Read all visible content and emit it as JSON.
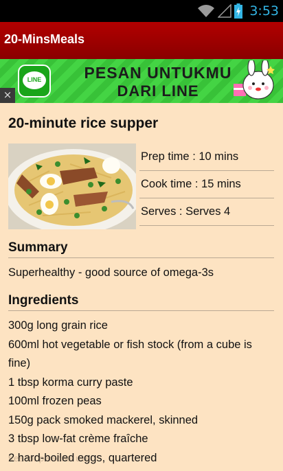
{
  "status_bar": {
    "time": "3:53",
    "icons": [
      "wifi-icon",
      "signal-icon",
      "battery-charging-icon"
    ],
    "time_color": "#33b5e5"
  },
  "app_bar": {
    "title": "20-MinsMeals",
    "color": "#a00000"
  },
  "ad": {
    "brand_label": "LINE",
    "line1": "PESAN UNTUKMU",
    "line2": "DARI LINE",
    "close_label": "×"
  },
  "recipe": {
    "title": "20-minute rice supper",
    "photo_alt": "rice dish with mackerel and eggs",
    "prep": "Prep time : 10 mins",
    "cook": "Cook time : 15 mins",
    "serves": "Serves : Serves 4",
    "summary_heading": "Summary",
    "summary": "Superhealthy - good source of omega-3s",
    "ingredients_heading": "Ingredients",
    "ingredients": [
      "300g long grain rice",
      "600ml hot vegetable or fish stock (from a cube is fine)",
      "1 tbsp korma curry paste",
      "100ml frozen peas",
      "150g pack smoked mackerel, skinned",
      "3 tbsp low-fat crème fraîche",
      "2 hard-boiled eggs, quartered"
    ]
  },
  "watermark": "free for personal use"
}
